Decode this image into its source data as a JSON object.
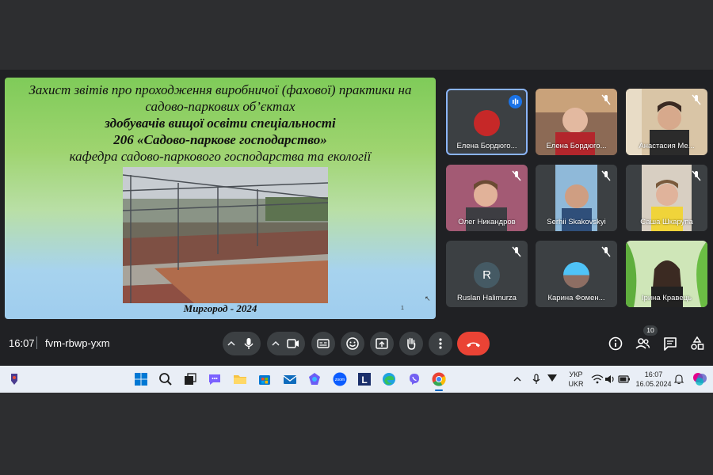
{
  "slide": {
    "title_line1": "Захист звітів про проходження виробничої (фахової) практики на",
    "title_line2": "садово-паркових об’єктах",
    "title_line3": "здобувачів вищої освіти спеціальності",
    "title_line4": "206 «Садово-паркове господарство»",
    "title_line5": "кафедра садово-паркового господарства та екології",
    "footer": "Миргород - 2024",
    "page_number": "1"
  },
  "participants": [
    {
      "name": "Елена Бордюго...",
      "state": "speaking",
      "avatar": "photo"
    },
    {
      "name": "Елена Бордюго...",
      "state": "muted",
      "avatar": "video"
    },
    {
      "name": "Анастасия Ме...",
      "state": "muted",
      "avatar": "video"
    },
    {
      "name": "Олег Никандров",
      "state": "muted",
      "avatar": "video"
    },
    {
      "name": "Serhii Skakovskyi",
      "state": "muted",
      "avatar": "video"
    },
    {
      "name": "Саша Шкарупа",
      "state": "muted",
      "avatar": "video"
    },
    {
      "name": "Ruslan Halimurza",
      "state": "muted",
      "avatar": "letter",
      "initial": "R"
    },
    {
      "name": "Карина Фомен...",
      "state": "muted",
      "avatar": "photo"
    },
    {
      "name": "Ірина Кравець",
      "state": "muted",
      "avatar": "video"
    }
  ],
  "controls": {
    "time": "16:07",
    "meeting_code": "fvm-rbwp-yxm",
    "people_count": "10",
    "end_call_color": "#ea4335",
    "accent_color": "#8ab4f8"
  },
  "taskbar": {
    "language_line1": "УКР",
    "language_line2": "UKR",
    "clock_time": "16:07",
    "clock_date": "16.05.2024",
    "apps": [
      "windows-icon",
      "search-icon",
      "task-view-icon",
      "chat-icon",
      "file-explorer-icon",
      "store-icon",
      "mail-icon",
      "copilot-icon",
      "zoom-icon",
      "l-app-icon",
      "edge-icon",
      "viber-icon",
      "chrome-icon"
    ]
  }
}
